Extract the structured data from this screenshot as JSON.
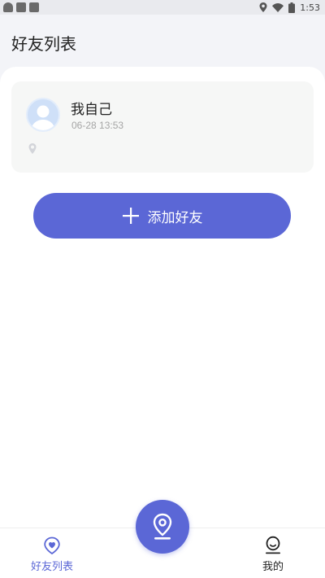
{
  "status_bar": {
    "time": "1:53",
    "icons": [
      "ghost-icon",
      "folder-icon",
      "sd-card-icon",
      "location-icon",
      "wifi-icon",
      "battery-icon"
    ]
  },
  "header": {
    "title": "好友列表"
  },
  "friends": [
    {
      "name": "我自己",
      "time": "06-28 13:53",
      "avatar_icon": "default-avatar-icon",
      "location_icon": "location-pin-icon"
    }
  ],
  "actions": {
    "add_friend_label": "添加好友",
    "add_friend_icon": "plus-icon"
  },
  "bottom_nav": {
    "items": [
      {
        "label": "好友列表",
        "icon": "heart-location-icon",
        "active": true
      },
      {
        "label": "我的",
        "icon": "user-icon",
        "active": false
      }
    ],
    "center_button_icon": "location-pin-icon"
  },
  "colors": {
    "accent": "#5b67d6",
    "background": "#f3f4f8",
    "card": "#f6f7f6",
    "muted_text": "#a5a5a5",
    "avatar_bg": "#cfe0f8"
  }
}
